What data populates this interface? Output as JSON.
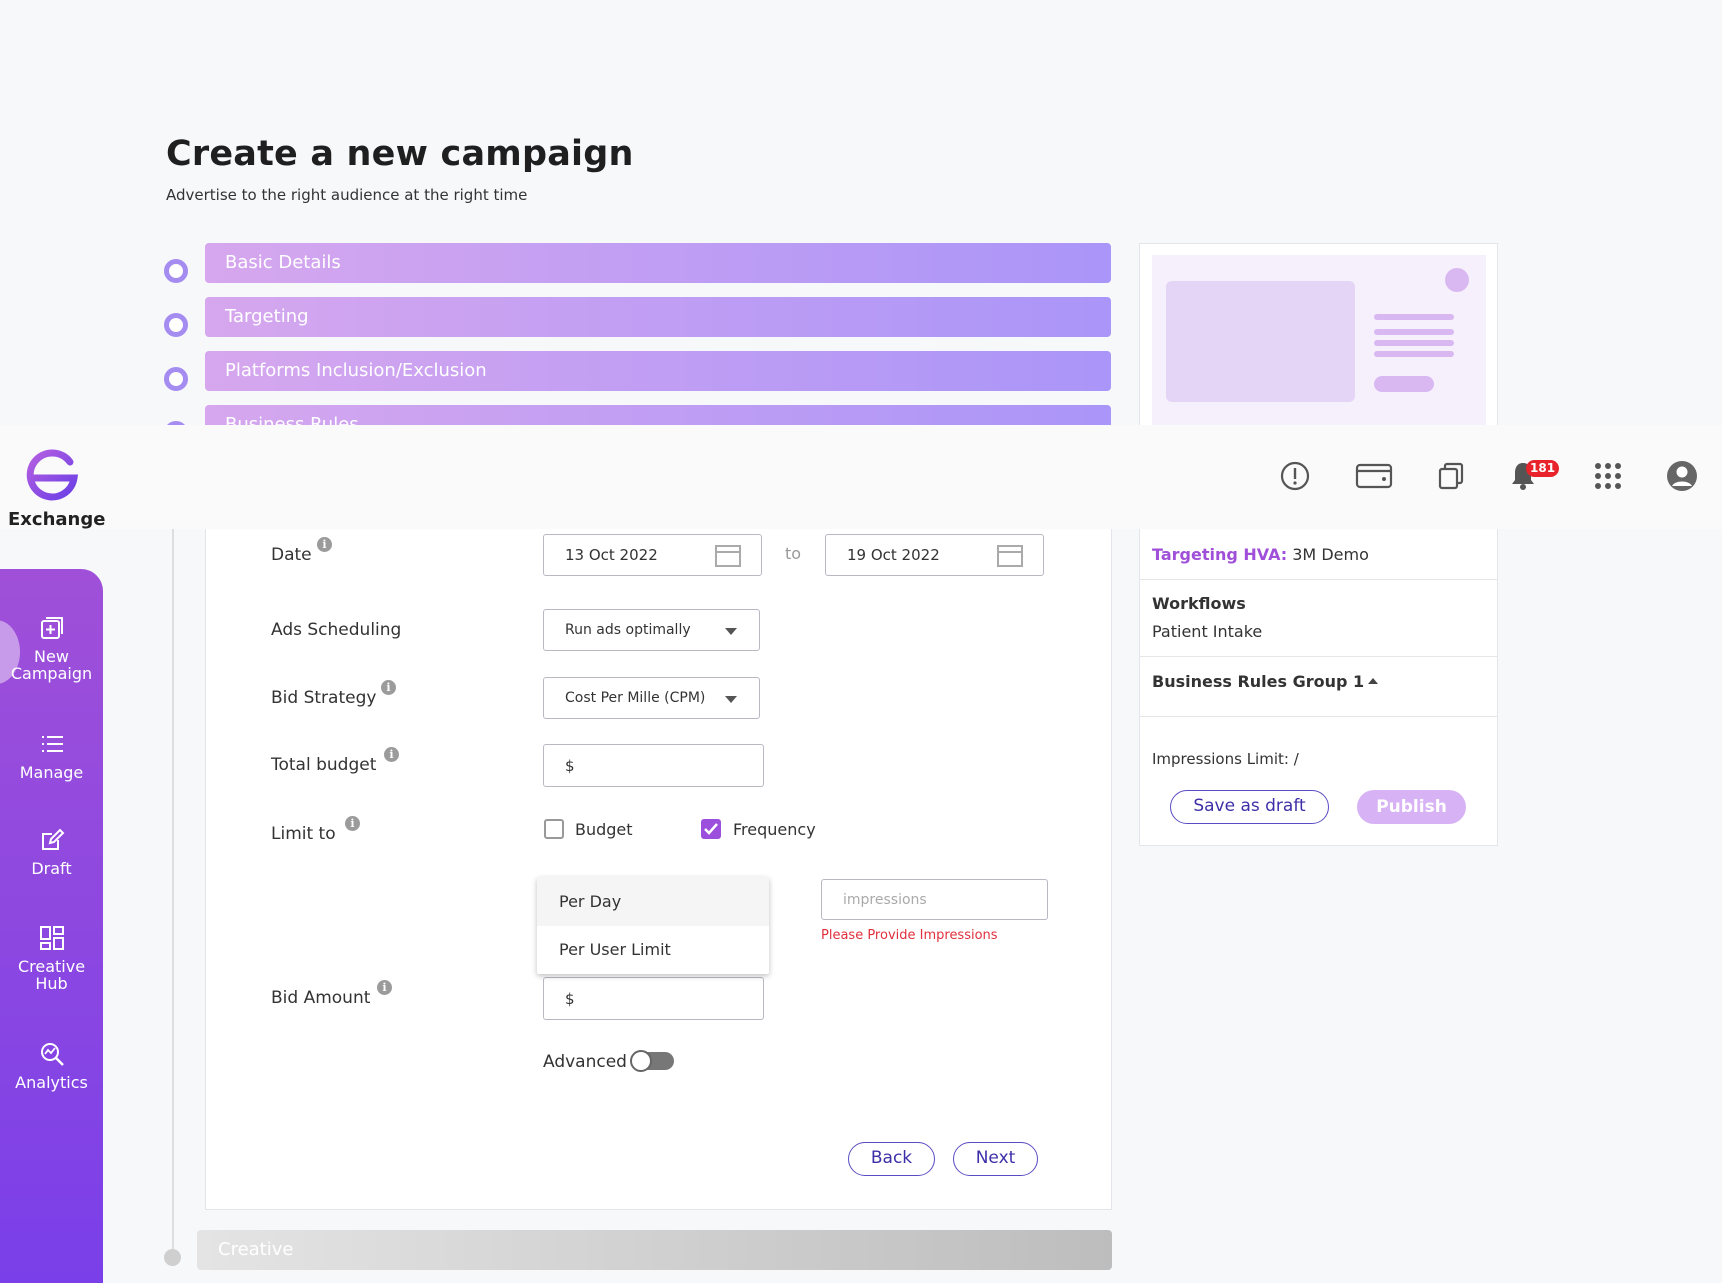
{
  "header": {
    "title": "Create a new campaign",
    "subtitle": "Advertise to the right audience at the right time"
  },
  "steps": [
    {
      "label": "Basic Details"
    },
    {
      "label": "Targeting"
    },
    {
      "label": "Platforms Inclusion/Exclusion"
    },
    {
      "label": "Business Rules"
    }
  ],
  "next_step": {
    "label": "Creative"
  },
  "brand": {
    "name": "Exchange",
    "accent": "#7a3fe9"
  },
  "topbar": {
    "icons": [
      "alert-icon",
      "wallet-icon",
      "copy-icon",
      "bell-icon",
      "apps-grid-icon",
      "account-icon"
    ],
    "notification_count": "181"
  },
  "sidebar": {
    "items": [
      {
        "label": "New Campaign",
        "icon": "new-campaign-icon"
      },
      {
        "label": "Manage",
        "icon": "list-icon"
      },
      {
        "label": "Draft",
        "icon": "edit-icon"
      },
      {
        "label": "Creative Hub",
        "icon": "grid-icon"
      },
      {
        "label": "Analytics",
        "icon": "analytics-icon"
      }
    ]
  },
  "form": {
    "date": {
      "label": "Date",
      "start": "13 Oct 2022",
      "separator": "to",
      "end": "19 Oct 2022"
    },
    "ads_scheduling": {
      "label": "Ads Scheduling",
      "value": "Run ads optimally"
    },
    "bid_strategy": {
      "label": "Bid Strategy",
      "value": "Cost Per Mille (CPM)"
    },
    "total_budget": {
      "label": "Total budget",
      "prefix": "$"
    },
    "limit_to": {
      "label": "Limit to",
      "budget": {
        "label": "Budget",
        "checked": false
      },
      "frequency": {
        "label": "Frequency",
        "checked": true
      }
    },
    "frequency_dropdown": {
      "options": [
        "Per Day",
        "Per User Limit"
      ],
      "highlighted": "Per Day"
    },
    "impressions": {
      "placeholder": "impressions",
      "error": "Please Provide Impressions"
    },
    "bid_amount": {
      "label": "Bid Amount",
      "prefix": "$"
    },
    "advanced": {
      "label": "Advanced",
      "on": false
    },
    "back_label": "Back",
    "next_label": "Next"
  },
  "summary": {
    "targeting_key": "Targeting HVA:",
    "targeting_value": "3M Demo",
    "workflows_key": "Workflows",
    "workflows_value": "Patient Intake",
    "rules_group": "Business Rules Group 1",
    "impressions_limit": "Impressions Limit: /",
    "save_draft_label": "Save as draft",
    "publish_label": "Publish"
  }
}
